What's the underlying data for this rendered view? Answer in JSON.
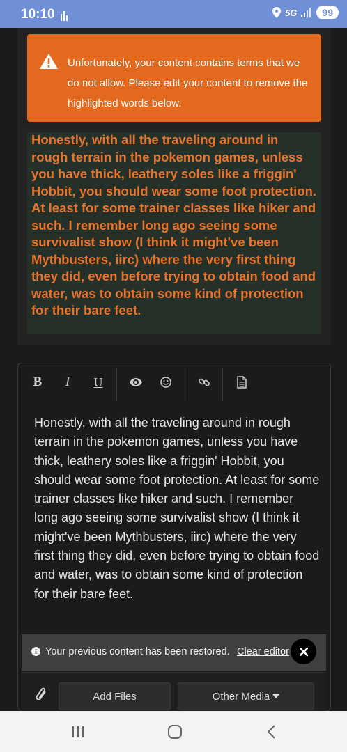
{
  "status": {
    "time": "10:10",
    "network": "5G",
    "battery": "99"
  },
  "warning": {
    "icon": "warning-triangle-icon",
    "message": "Unfortunately, your content contains terms that we do not allow. Please edit your content to remove the highlighted words below."
  },
  "preview": {
    "text": "Honestly, with all the traveling around in rough terrain in the pokemon games, unless you have thick, leathery soles like a friggin' Hobbit, you should wear some foot protection. At least for some trainer classes like hiker and such. I remember long ago seeing some survivalist show (I think it might've been Mythbusters, iirc) where the very first thing they did, even before trying to obtain food and water, was to obtain some kind of protection for their bare feet."
  },
  "toolbar": {
    "bold": "B",
    "italic": "I",
    "underline": "U"
  },
  "editor": {
    "text": "Honestly, with all the traveling around in rough terrain in the pokemon games, unless you have thick, leathery soles like a friggin' Hobbit, you should wear some foot protection. At least for some trainer classes like hiker and such. I remember long ago seeing some survivalist show (I think it might've been Mythbusters, iirc) where the very first thing they did, even before trying to obtain food and water, was to obtain some kind of protection for their bare feet."
  },
  "notice": {
    "message": "Your previous content has been restored.",
    "link": "Clear editor"
  },
  "attachments": {
    "add_files": "Add Files",
    "other_media": "Other Media"
  },
  "colors": {
    "warning": "#e2691e",
    "highlight_text": "#e8742d",
    "status_bar": "#6f8fd6"
  }
}
